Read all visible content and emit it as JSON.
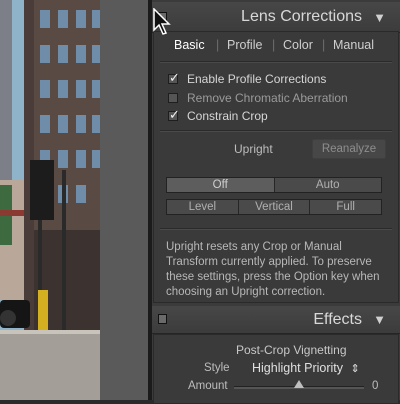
{
  "lens_corrections": {
    "title": "Lens Corrections",
    "tabs": [
      {
        "label": "Basic",
        "active": true
      },
      {
        "label": "Profile",
        "active": false
      },
      {
        "label": "Color",
        "active": false
      },
      {
        "label": "Manual",
        "active": false
      }
    ],
    "checkboxes": [
      {
        "label": "Enable Profile Corrections",
        "checked": true
      },
      {
        "label": "Remove Chromatic Aberration",
        "checked": false
      },
      {
        "label": "Constrain Crop",
        "checked": true
      }
    ],
    "upright": {
      "label": "Upright",
      "reanalyze_label": "Reanalyze",
      "row1": [
        "Off",
        "Auto"
      ],
      "row2": [
        "Level",
        "Vertical",
        "Full"
      ],
      "selected": "Off",
      "note": "Upright resets any Crop or Manual Transform currently applied. To preserve these settings, press the Option key when choosing an Upright correction."
    }
  },
  "effects": {
    "title": "Effects",
    "subtitle": "Post-Crop Vignetting",
    "style_label": "Style",
    "style_value": "Highlight Priority",
    "style_arrows": "⇕",
    "amount_label": "Amount",
    "amount_value": "0",
    "amount_fraction": 0.5
  },
  "colors": {
    "panel_bg": "#3b3b3b",
    "header_bg": "#474747",
    "text": "#d6d6d6"
  }
}
